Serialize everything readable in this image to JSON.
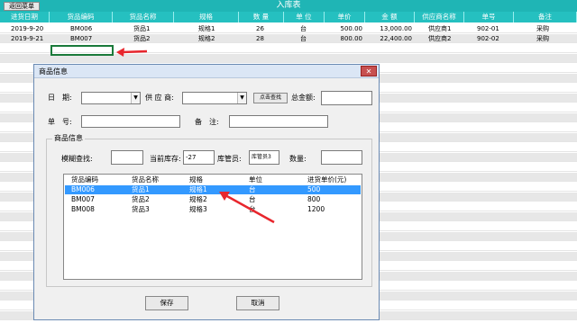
{
  "toolbar": {
    "return_label": "返回菜单",
    "sheet_title": "入库表"
  },
  "sheet": {
    "columns": [
      "进货日期",
      "货品编码",
      "货品名称",
      "规格",
      "数 量",
      "单 位",
      "单价",
      "金 额",
      "供应商名称",
      "单号",
      "备注"
    ],
    "rows": [
      [
        "2019-9-20",
        "BM006",
        "货品1",
        "规格1",
        "26",
        "台",
        "500.00",
        "13,000.00",
        "供应商1",
        "902-01",
        "采购"
      ],
      [
        "2019-9-21",
        "BM007",
        "货品2",
        "规格2",
        "28",
        "台",
        "800.00",
        "22,400.00",
        "供应商2",
        "902-02",
        "采购"
      ]
    ]
  },
  "dialog": {
    "title": "商品信息",
    "close_glyph": "✕",
    "date_label": "日　期:",
    "supplier_label": "供 应 商:",
    "search_button": "点击查找",
    "total_label": "总金额:",
    "order_label": "单　号:",
    "remark_label": "备　注:",
    "group_label": "商品信息",
    "fuzzy_label": "模糊查找:",
    "stock_label": "当前库存:",
    "stock_value": "-27",
    "keeper_label": "库管员:",
    "keeper_value": "库管员3",
    "qty_label": "数量:",
    "list_headers": [
      "货品编码",
      "货品名称",
      "规格",
      "单位",
      "进货单价(元)"
    ],
    "list_rows": [
      [
        "BM006",
        "货品1",
        "规格1",
        "台",
        "500"
      ],
      [
        "BM007",
        "货品2",
        "规格2",
        "台",
        "800"
      ],
      [
        "BM008",
        "货品3",
        "规格3",
        "台",
        "1200"
      ]
    ],
    "save_button": "保存",
    "cancel_button": "取消"
  },
  "colors": {
    "header": "#25c0c0",
    "selection": "#3399ff",
    "arrow": "#e8262d"
  }
}
